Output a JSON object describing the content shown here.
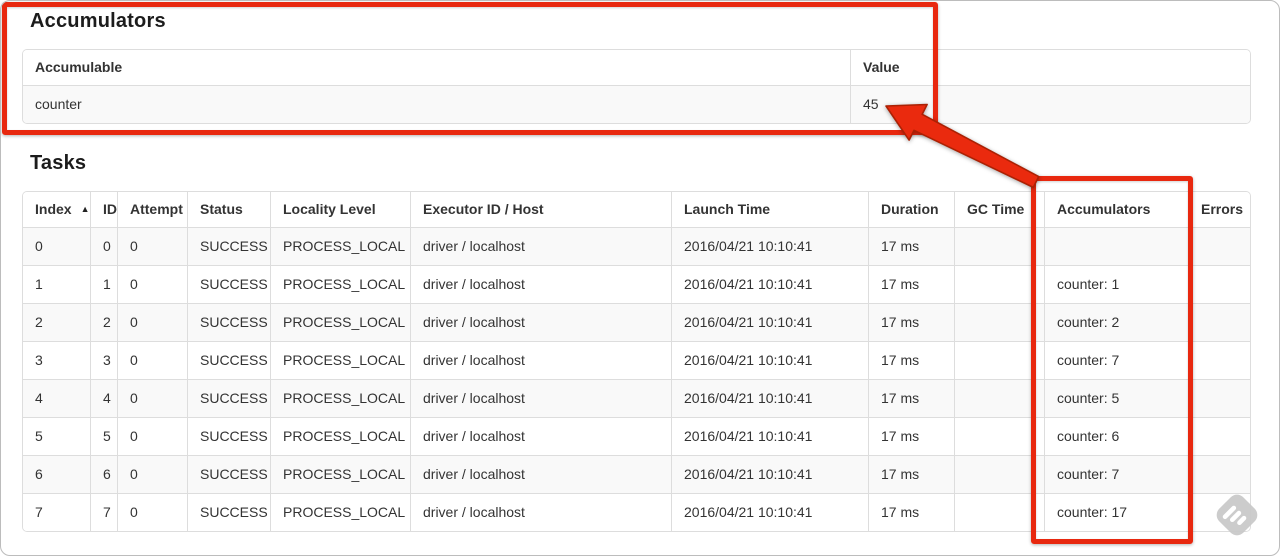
{
  "accumulators_section": {
    "heading": "Accumulators",
    "table": {
      "headers": [
        "Accumulable",
        "Value"
      ],
      "sortable": false,
      "rows": [
        [
          "counter",
          "45"
        ]
      ]
    }
  },
  "tasks_section": {
    "heading": "Tasks",
    "table": {
      "headers": [
        "Index",
        "ID",
        "Attempt",
        "Status",
        "Locality Level",
        "Executor ID / Host",
        "Launch Time",
        "Duration",
        "GC Time",
        "Accumulators",
        "Errors"
      ],
      "sortable": true,
      "sort": {
        "column": "Index",
        "direction": "asc",
        "icon": "▲"
      },
      "rows": [
        [
          "0",
          "0",
          "0",
          "SUCCESS",
          "PROCESS_LOCAL",
          "driver / localhost",
          "2016/04/21 10:10:41",
          "17 ms",
          "",
          "",
          ""
        ],
        [
          "1",
          "1",
          "0",
          "SUCCESS",
          "PROCESS_LOCAL",
          "driver / localhost",
          "2016/04/21 10:10:41",
          "17 ms",
          "",
          "counter: 1",
          ""
        ],
        [
          "2",
          "2",
          "0",
          "SUCCESS",
          "PROCESS_LOCAL",
          "driver / localhost",
          "2016/04/21 10:10:41",
          "17 ms",
          "",
          "counter: 2",
          ""
        ],
        [
          "3",
          "3",
          "0",
          "SUCCESS",
          "PROCESS_LOCAL",
          "driver / localhost",
          "2016/04/21 10:10:41",
          "17 ms",
          "",
          "counter: 7",
          ""
        ],
        [
          "4",
          "4",
          "0",
          "SUCCESS",
          "PROCESS_LOCAL",
          "driver / localhost",
          "2016/04/21 10:10:41",
          "17 ms",
          "",
          "counter: 5",
          ""
        ],
        [
          "5",
          "5",
          "0",
          "SUCCESS",
          "PROCESS_LOCAL",
          "driver / localhost",
          "2016/04/21 10:10:41",
          "17 ms",
          "",
          "counter: 6",
          ""
        ],
        [
          "6",
          "6",
          "0",
          "SUCCESS",
          "PROCESS_LOCAL",
          "driver / localhost",
          "2016/04/21 10:10:41",
          "17 ms",
          "",
          "counter: 7",
          ""
        ],
        [
          "7",
          "7",
          "0",
          "SUCCESS",
          "PROCESS_LOCAL",
          "driver / localhost",
          "2016/04/21 10:10:41",
          "17 ms",
          "",
          "counter: 17",
          ""
        ]
      ]
    }
  },
  "annotations": {
    "accent_color": "#e8280f",
    "boxes": [
      {
        "name": "accumulators-section-highlight"
      },
      {
        "name": "accumulators-column-highlight"
      }
    ],
    "arrow": {
      "points_to": "45"
    }
  },
  "watermark": {
    "icon": "skitch-logo"
  }
}
